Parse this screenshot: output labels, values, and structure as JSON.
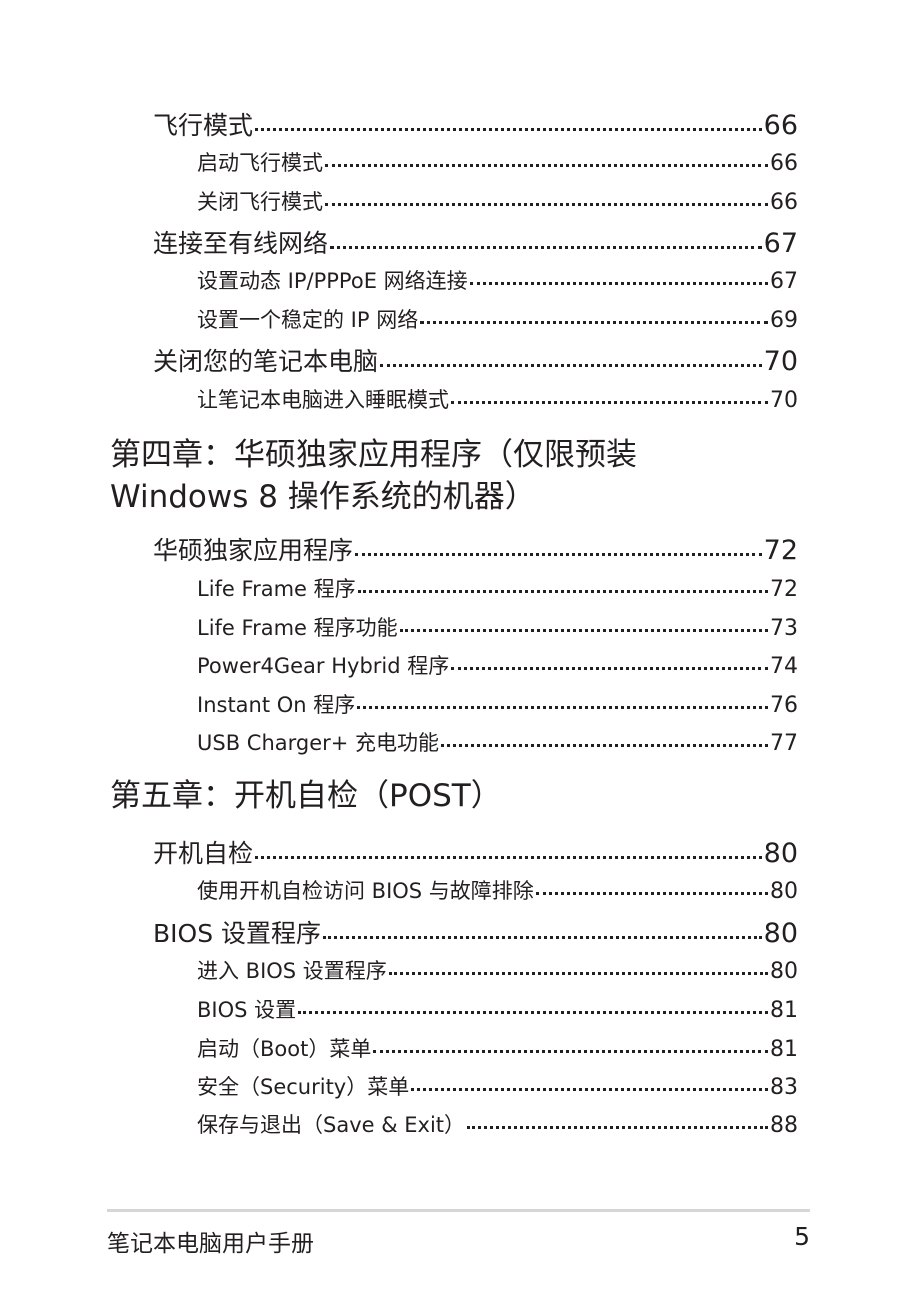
{
  "toc": {
    "group1": [
      {
        "level": 1,
        "title": "飞行模式",
        "page": "66"
      },
      {
        "level": 2,
        "title": "启动飞行模式",
        "page": "66"
      },
      {
        "level": 2,
        "title": "关闭飞行模式",
        "page": "66"
      },
      {
        "level": 1,
        "title": "连接至有线网络",
        "page": "67"
      },
      {
        "level": 2,
        "title": "设置动态 IP/PPPoE 网络连接",
        "page": "67"
      },
      {
        "level": 2,
        "title": "设置一个稳定的 IP 网络",
        "page": "69"
      },
      {
        "level": 1,
        "title": "关闭您的笔记本电脑",
        "page": "70"
      },
      {
        "level": 2,
        "title": "让笔记本电脑进入睡眠模式",
        "page": "70"
      }
    ],
    "chapter4": {
      "title_line1": "第四章：华硕独家应用程序（仅限预装",
      "title_line2": "Windows 8 操作系统的机器）",
      "entries": [
        {
          "level": 1,
          "title": "华硕独家应用程序",
          "page": "72"
        },
        {
          "level": 2,
          "title": "Life Frame 程序",
          "page": "72"
        },
        {
          "level": 2,
          "title": "Life Frame 程序功能",
          "page": "73"
        },
        {
          "level": 2,
          "title": "Power4Gear Hybrid 程序",
          "page": "74"
        },
        {
          "level": 2,
          "title": "Instant On 程序",
          "page": "76"
        },
        {
          "level": 2,
          "title": "USB Charger+ 充电功能",
          "page": "77"
        }
      ]
    },
    "chapter5": {
      "title": "第五章：开机自检（POST）",
      "entries": [
        {
          "level": 1,
          "title": "开机自检",
          "page": "80"
        },
        {
          "level": 2,
          "title": "使用开机自检访问 BIOS 与故障排除",
          "page": "80"
        },
        {
          "level": 1,
          "title": "BIOS 设置程序",
          "page": "80"
        },
        {
          "level": 2,
          "title": "进入 BIOS 设置程序",
          "page": "80"
        },
        {
          "level": 2,
          "title": "BIOS 设置",
          "page": "81"
        },
        {
          "level": 2,
          "title": "启动（Boot）菜单",
          "page": "81"
        },
        {
          "level": 2,
          "title": "安全（Security）菜单",
          "page": "83"
        },
        {
          "level": 2,
          "title": "保存与退出（Save & Exit）",
          "page": "88"
        }
      ]
    }
  },
  "footer": {
    "manual_title": "笔记本电脑用户手册",
    "page_number": "5"
  }
}
